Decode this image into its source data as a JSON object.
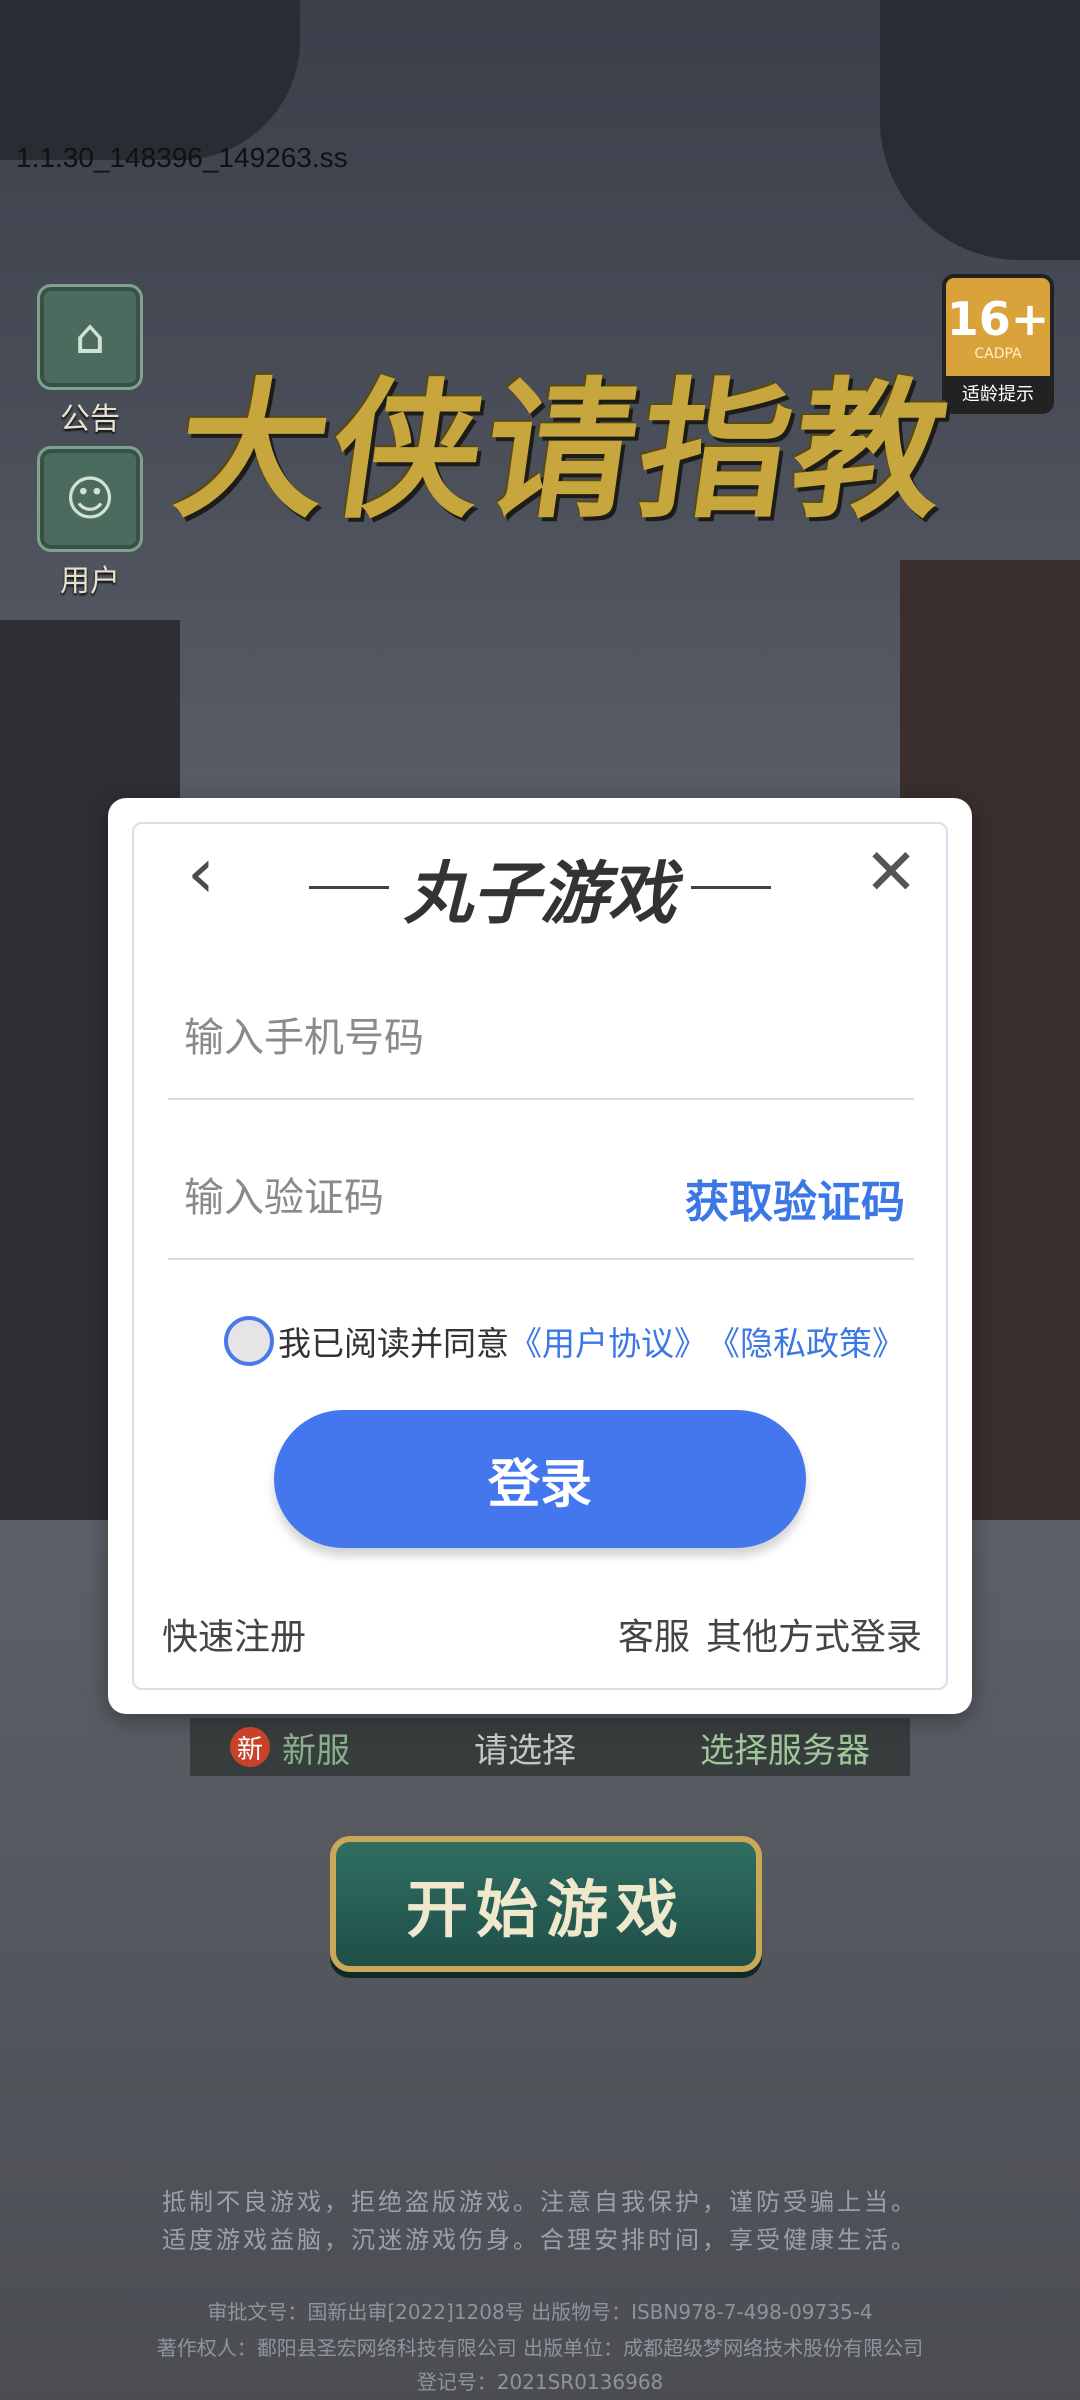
{
  "app": {
    "version_label": "1.1.30_148396_149263.ss",
    "game_title": "大侠请指教",
    "age_rating": {
      "number": "16+",
      "org": "CADPA",
      "tip": "适龄提示"
    },
    "side_buttons": [
      {
        "label": "公告",
        "icon": "pagoda-icon"
      },
      {
        "label": "用户",
        "icon": "user-avatar-icon"
      }
    ]
  },
  "login_dialog": {
    "brand": "丸子游戏",
    "back_icon": "chevron-left-icon",
    "close_icon": "close-icon",
    "phone_placeholder": "输入手机号码",
    "code_placeholder": "输入验证码",
    "get_code_label": "获取验证码",
    "agreement": {
      "prefix": "我已阅读并同意",
      "user_agreement": "《用户协议》",
      "privacy_policy": "《隐私政策》"
    },
    "login_label": "登录",
    "quick_register": "快速注册",
    "customer_service": "客服",
    "other_login": "其他方式登录"
  },
  "server_bar": {
    "new_badge": "新",
    "new_label": "新服",
    "choose_label": "请选择",
    "select_server_label": "选择服务器"
  },
  "start_button_label": "开始游戏",
  "health_notice": [
    "抵制不良游戏，拒绝盗版游戏。注意自我保护，谨防受骗上当。",
    "适度游戏益脑，沉迷游戏伤身。合理安排时间，享受健康生活。"
  ],
  "legal": [
    "审批文号：国新出审[2022]1208号 出版物号：ISBN978-7-498-09735-4",
    "著作权人：鄱阳县圣宏网络科技有限公司 出版单位：成都超级梦网络技术股份有限公司",
    "登记号：2021SR0136968"
  ],
  "colors": {
    "accent_blue": "#4476ee",
    "link_blue": "#3c77e6",
    "title_gold": "#c8a63e"
  }
}
